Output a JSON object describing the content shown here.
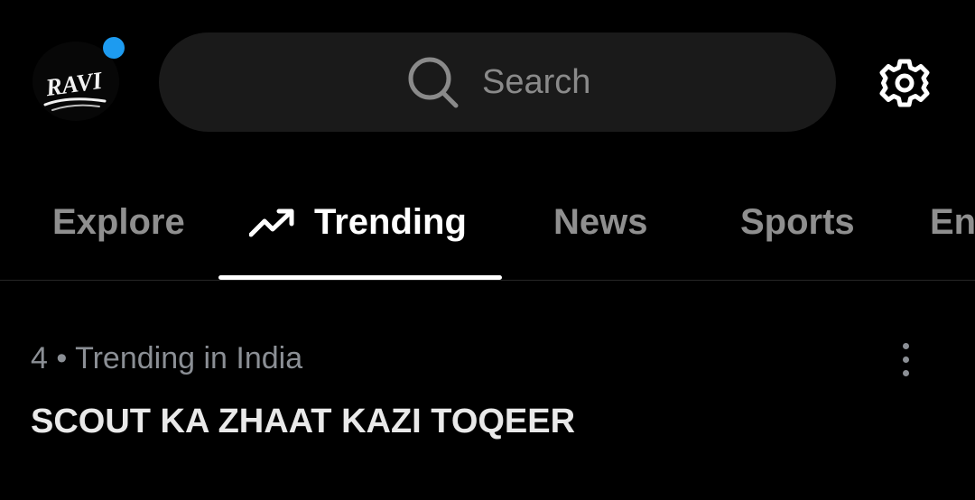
{
  "header": {
    "avatar_text": "RAVI",
    "search_placeholder": "Search",
    "avatar_icon": "avatar-logo",
    "notification_dot_color": "#1d9bf0",
    "settings_icon": "gear-icon"
  },
  "tabs": [
    {
      "label": "Explore"
    },
    {
      "label": "Trending",
      "icon": "trending-arrow-icon"
    },
    {
      "label": "News"
    },
    {
      "label": "Sports"
    },
    {
      "label": "Ent"
    }
  ],
  "active_tab": "Trending",
  "trend": {
    "meta": "4 • Trending in India",
    "title": "SCOUT KA ZHAAT KAZI TOQEER",
    "more_icon": "more-vertical-icon"
  },
  "colors": {
    "background": "#000000",
    "search_bg": "#1a1a1a",
    "muted_text": "#8b8f95",
    "accent": "#1d9bf0"
  }
}
